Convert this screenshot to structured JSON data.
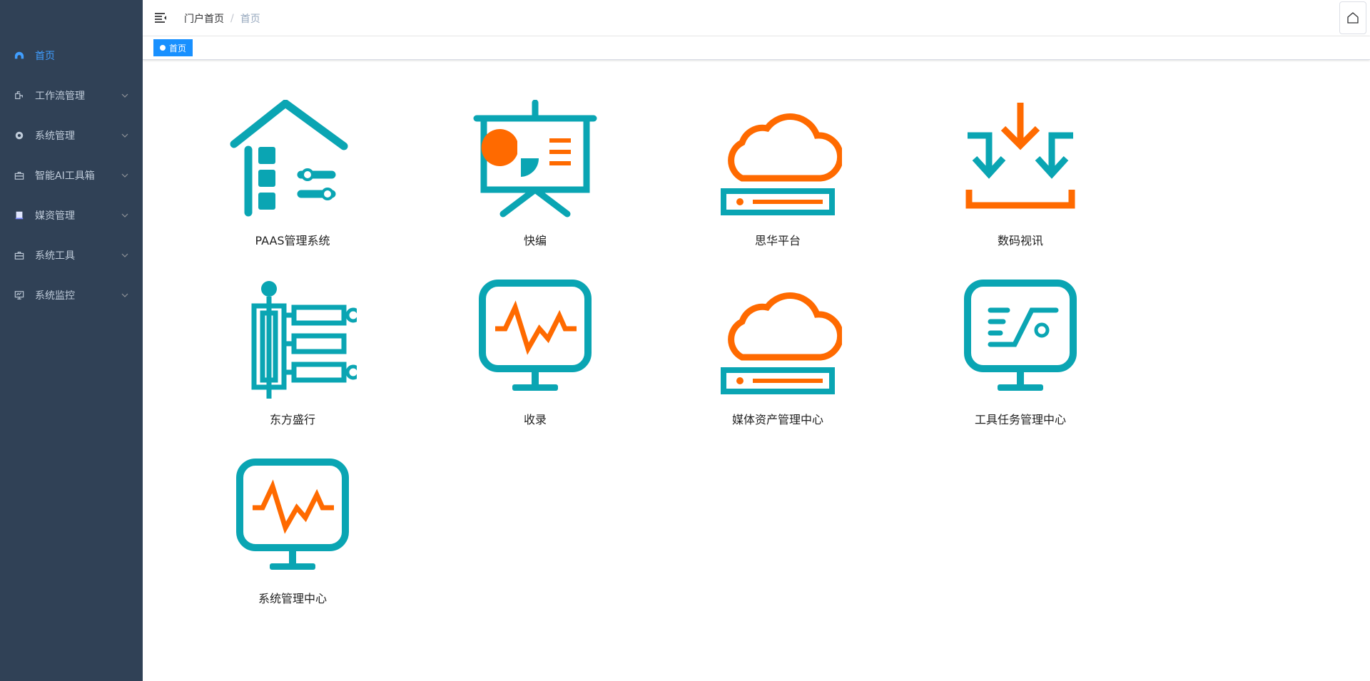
{
  "sidebar": {
    "items": [
      {
        "label": "首页",
        "icon": "dashboard-icon"
      },
      {
        "label": "工作流管理",
        "icon": "workflow-icon"
      },
      {
        "label": "系统管理",
        "icon": "gear-icon"
      },
      {
        "label": "智能AI工具箱",
        "icon": "toolbox-icon"
      },
      {
        "label": "媒资管理",
        "icon": "media-icon"
      },
      {
        "label": "系统工具",
        "icon": "toolbox-icon"
      },
      {
        "label": "系统监控",
        "icon": "monitor-icon"
      }
    ]
  },
  "navbar": {
    "breadcrumb": [
      "门户首页",
      "首页"
    ]
  },
  "tags": {
    "active": "首页"
  },
  "apps": [
    {
      "label": "PAAS管理系统",
      "icon": "house-settings-icon"
    },
    {
      "label": "快编",
      "icon": "presentation-board-icon"
    },
    {
      "label": "思华平台",
      "icon": "cloud-server-icon"
    },
    {
      "label": "数码视讯",
      "icon": "inbox-download-icon"
    },
    {
      "label": "东方盛行",
      "icon": "server-rack-icon"
    },
    {
      "label": "收录",
      "icon": "monitor-pulse-icon"
    },
    {
      "label": "媒体资产管理中心",
      "icon": "cloud-server-icon"
    },
    {
      "label": "工具任务管理中心",
      "icon": "monitor-dashboard-icon"
    },
    {
      "label": "系统管理中心",
      "icon": "monitor-pulse-icon"
    }
  ],
  "colors": {
    "teal": "#0aa5b3",
    "orange": "#ff6a00",
    "sidebar_bg": "#304156",
    "accent": "#1890ff"
  }
}
